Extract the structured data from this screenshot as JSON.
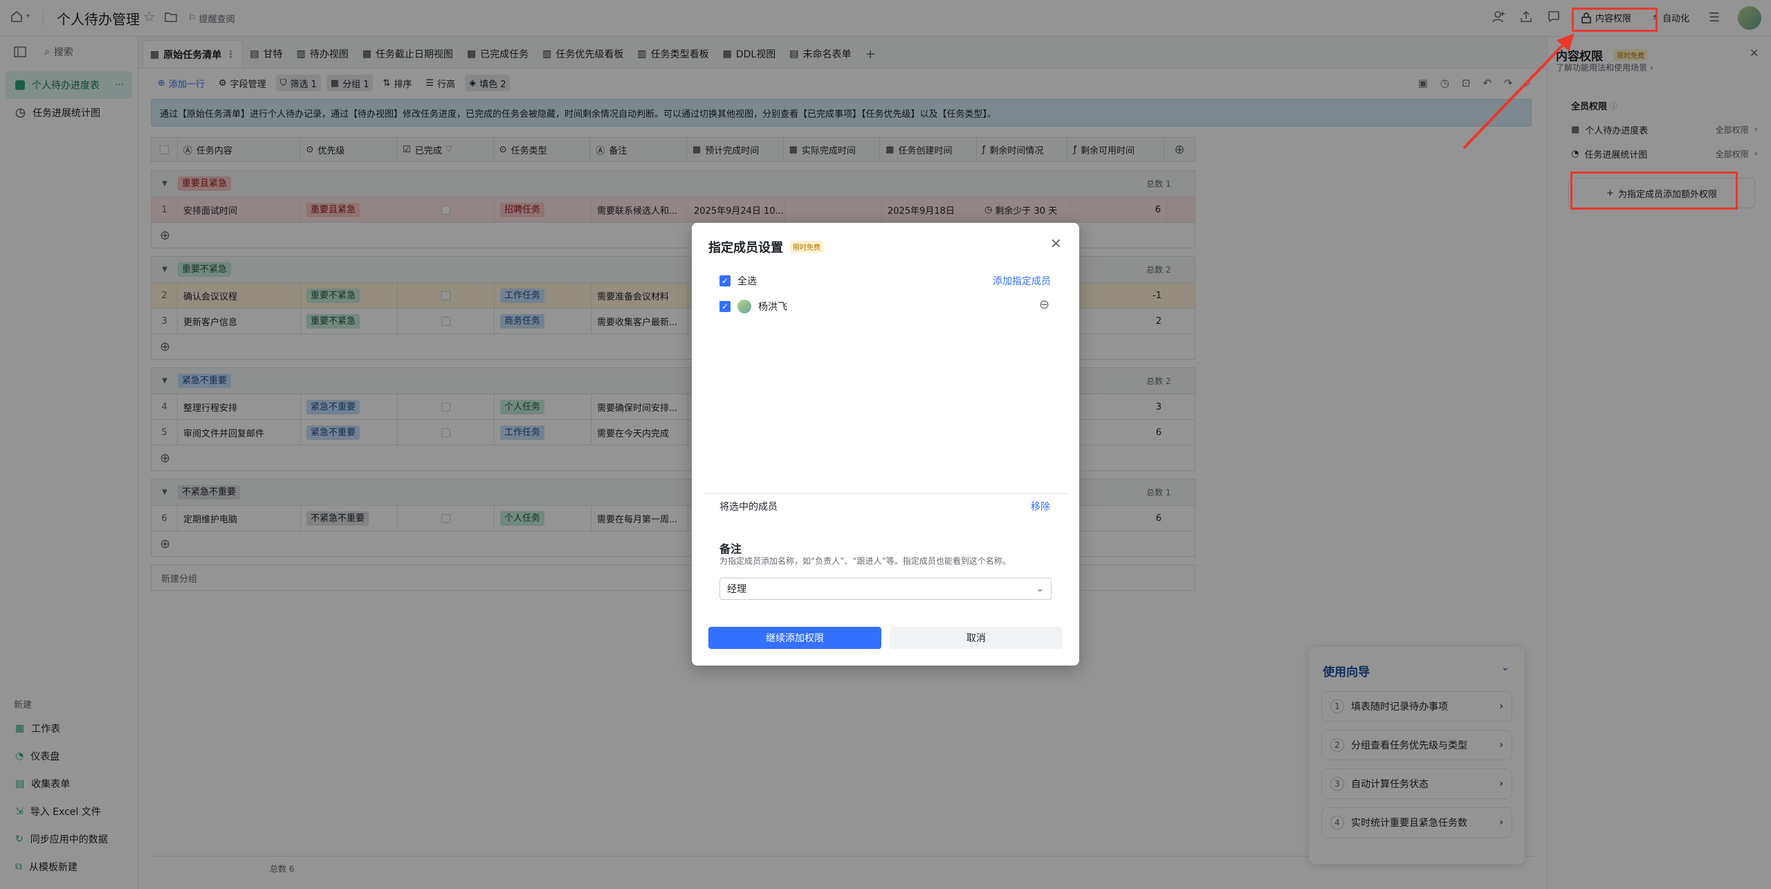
{
  "doc": {
    "title": "个人待办管理",
    "remind_label": "提醒查阅"
  },
  "topbar": {
    "content_perm_label": "内容权限",
    "automation_label": "自动化"
  },
  "sidebar": {
    "search_label": "搜索",
    "tables": [
      {
        "label": "个人待办进度表",
        "active": true
      },
      {
        "label": "任务进展统计图",
        "active": false
      }
    ],
    "new_label": "新建",
    "new_items": [
      {
        "label": "工作表",
        "icon": "table-icon"
      },
      {
        "label": "仪表盘",
        "icon": "dashboard-icon"
      },
      {
        "label": "收集表单",
        "icon": "form-icon"
      },
      {
        "label": "导入 Excel 文件",
        "icon": "import-icon"
      },
      {
        "label": "同步应用中的数据",
        "icon": "sync-icon"
      },
      {
        "label": "从模板新建",
        "icon": "template-icon"
      }
    ]
  },
  "tabs": [
    {
      "label": "原始任务清单",
      "active": true
    },
    {
      "label": "甘特",
      "active": false
    },
    {
      "label": "待办视图",
      "active": false
    },
    {
      "label": "任务截止日期视图",
      "active": false
    },
    {
      "label": "已完成任务",
      "active": false
    },
    {
      "label": "任务优先级看板",
      "active": false
    },
    {
      "label": "任务类型看板",
      "active": false
    },
    {
      "label": "DDL视图",
      "active": false
    },
    {
      "label": "未命名表单",
      "active": false
    }
  ],
  "toolbar": {
    "add_row": "添加一行",
    "fields": "字段管理",
    "filter": "筛选 1",
    "group": "分组 1",
    "sort": "排序",
    "row_height": "行高",
    "color": "填色 2"
  },
  "banner": "通过【原始任务清单】进行个人待办记录，通过【待办视图】修改任务进度，已完成的任务会被隐藏，时间剩余情况自动判断。可以通过切换其他视图，分别查看【已完成事项】【任务优先级】以及【任务类型】。",
  "columns": [
    "任务内容",
    "优先级",
    "已完成",
    "任务类型",
    "备注",
    "预计完成时间",
    "实际完成时间",
    "任务创建时间",
    "剩余时间情况",
    "剩余可用时间"
  ],
  "groups": [
    {
      "name": "重要且紧急",
      "count": "总数 1",
      "tag": "red",
      "rows": [
        {
          "no": "1",
          "task": "安排面试时间",
          "priority": "重要且紧急",
          "type": "招聘任务",
          "note": "需要联系候选人和...",
          "due": "2025年9月24日 10...",
          "actual": "",
          "created": "2025年9月18日",
          "remain": "剩余少于 30 天",
          "avail": "6"
        }
      ]
    },
    {
      "name": "重要不紧急",
      "count": "总数 2",
      "tag": "green",
      "rows": [
        {
          "no": "2",
          "task": "确认会议议程",
          "priority": "重要不紧急",
          "type": "工作任务",
          "note": "需要准备会议材料",
          "avail": "-1"
        },
        {
          "no": "3",
          "task": "更新客户信息",
          "priority": "重要不紧急",
          "type": "商务任务",
          "note": "需要收集客户最新...",
          "avail": "2"
        }
      ]
    },
    {
      "name": "紧急不重要",
      "count": "总数 2",
      "tag": "blue",
      "rows": [
        {
          "no": "4",
          "task": "整理行程安排",
          "priority": "紧急不重要",
          "type": "个人任务",
          "note": "需要确保时间安排...",
          "avail": "3"
        },
        {
          "no": "5",
          "task": "审阅文件并回复邮件",
          "priority": "紧急不重要",
          "type": "工作任务",
          "note": "需要在今天内完成",
          "avail": "6"
        }
      ]
    },
    {
      "name": "不紧急不重要",
      "count": "总数 1",
      "tag": "gray",
      "rows": [
        {
          "no": "6",
          "task": "定期维护电脑",
          "priority": "不紧急不重要",
          "type": "个人任务",
          "note": "需要在每月第一周...",
          "avail": "6"
        }
      ]
    }
  ],
  "new_group": "新建分组",
  "footer_count": "总数 6",
  "dialog": {
    "title": "指定成员设置",
    "badge": "限时免费",
    "select_all": "全选",
    "add_member": "添加指定成员",
    "member": "杨洪飞",
    "selected_label": "将选中的成员",
    "remove": "移除",
    "note_title": "备注",
    "note_desc": "为指定成员添加名称，如“负责人”、“跟进人”等。指定成员也能看到这个名称。",
    "note_value": "经理",
    "primary_btn": "继续添加权限",
    "cancel_btn": "取消"
  },
  "panel": {
    "title": "内容权限",
    "badge": "限时免费",
    "learn": "了解功能用法和使用场景",
    "all_perm": "全员权限",
    "items": [
      {
        "label": "个人待办进度表",
        "value": "全部权限"
      },
      {
        "label": "任务进展统计图",
        "value": "全部权限"
      }
    ],
    "add_extra": "为指定成员添加额外权限"
  },
  "guide": {
    "title": "使用向导",
    "items": [
      "填表随时记录待办事项",
      "分组查看任务优先级与类型",
      "自动计算任务状态",
      "实时统计重要且紧急任务数"
    ]
  },
  "colors": {
    "primary": "#3370ff",
    "annotation_red": "#e8392c"
  }
}
